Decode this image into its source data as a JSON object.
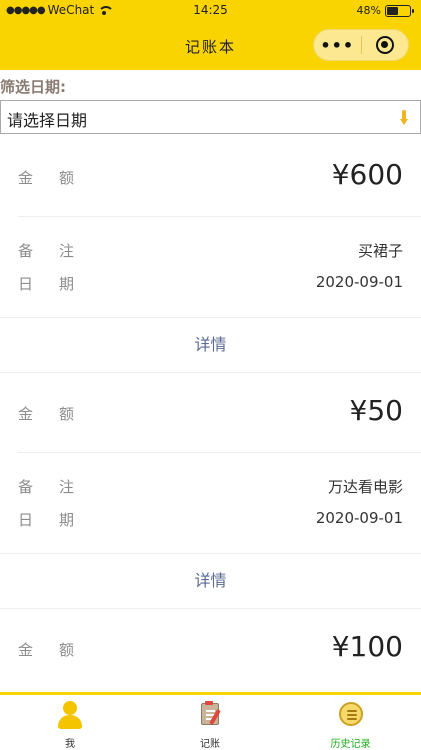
{
  "status_bar": {
    "carrier": "WeChat",
    "signal": "●●●●●",
    "time": "14:25",
    "battery_text": "48%",
    "battery_level": 0.48
  },
  "nav": {
    "title": "记账本",
    "more_icon": "•••"
  },
  "filter": {
    "label": "筛选日期:",
    "placeholder": "请选择日期"
  },
  "fields": {
    "amount": "金额",
    "note": "备注",
    "date": "日期"
  },
  "detail_label": "详情",
  "records": [
    {
      "amount": "¥600",
      "note": "买裙子",
      "date": "2020-09-01"
    },
    {
      "amount": "¥50",
      "note": "万达看电影",
      "date": "2020-09-01"
    },
    {
      "amount": "¥100",
      "note": "",
      "date": ""
    }
  ],
  "tabs": [
    {
      "label": "我",
      "icon": "person-icon"
    },
    {
      "label": "记账",
      "icon": "notebook-icon"
    },
    {
      "label": "历史记录",
      "icon": "history-icon"
    }
  ],
  "colors": {
    "accent": "#f9d400",
    "active_tab": "#1aad19",
    "link": "#5b6a92"
  }
}
